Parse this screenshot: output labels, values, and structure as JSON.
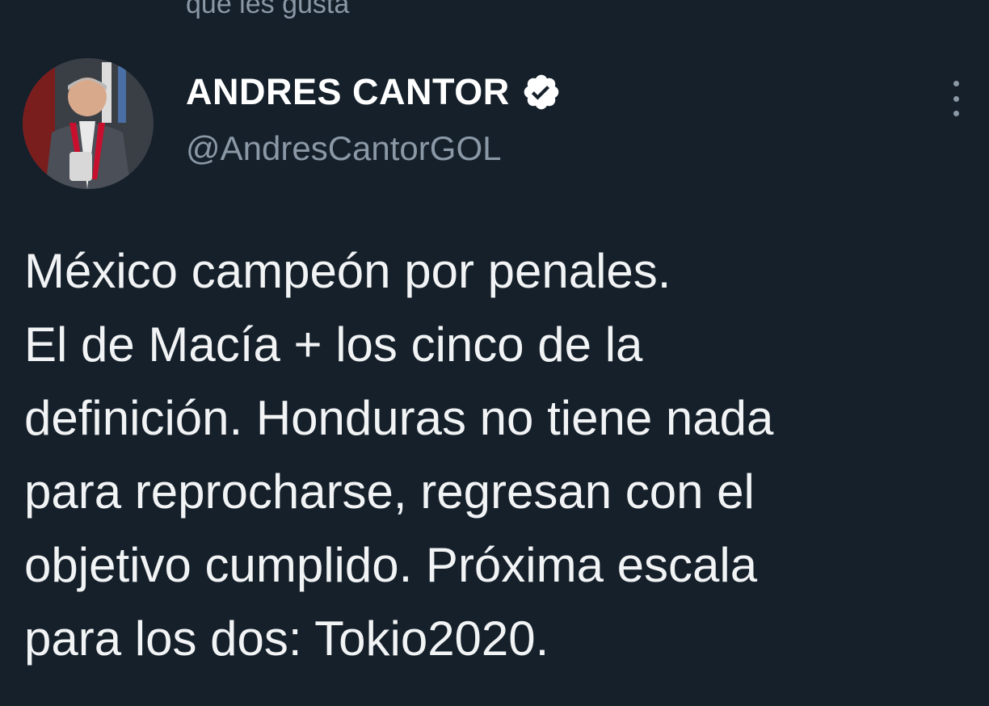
{
  "context": {
    "text": "que les gusta"
  },
  "author": {
    "name": "ANDRES CANTOR",
    "handle": "@AndresCantorGOL",
    "verified": true,
    "avatar_icon": "profile-photo"
  },
  "tweet": {
    "lines": [
      "México campeón por penales.",
      "El de Macía + los cinco de la",
      "definición. Honduras no tiene nada",
      "para reprocharse, regresan con el",
      "objetivo cumplido. Próxima escala",
      "para los dos: Tokio2020."
    ]
  },
  "colors": {
    "background": "#15202b",
    "text": "#e7e9ea",
    "secondary": "#8b98a5"
  },
  "icons": {
    "verified": "verified-badge-icon",
    "more": "more-options-icon"
  }
}
